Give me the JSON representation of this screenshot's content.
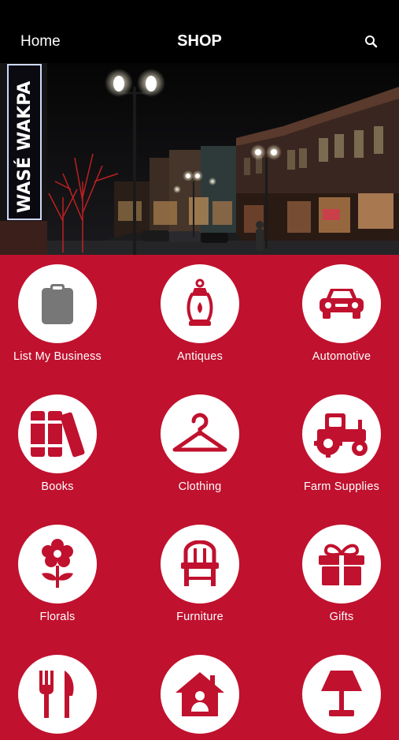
{
  "nav": {
    "left_label": "Home",
    "title": "SHOP",
    "search_icon": "search-icon"
  },
  "hero": {
    "sign_text": "WASÉ WAKPA",
    "description": "night-street-banner"
  },
  "colors": {
    "brand_red": "#c0112e",
    "topbar": "#000000",
    "icon_gray": "#7a7a7a"
  },
  "categories": [
    {
      "label": "List My Business",
      "icon": "clipboard-icon"
    },
    {
      "label": "Antiques",
      "icon": "lantern-icon"
    },
    {
      "label": "Automotive",
      "icon": "car-icon"
    },
    {
      "label": "Books",
      "icon": "books-icon"
    },
    {
      "label": "Clothing",
      "icon": "hanger-icon"
    },
    {
      "label": "Farm Supplies",
      "icon": "tractor-icon"
    },
    {
      "label": "Florals",
      "icon": "flower-icon"
    },
    {
      "label": "Furniture",
      "icon": "chair-icon"
    },
    {
      "label": "Gifts",
      "icon": "gift-icon"
    },
    {
      "label": "",
      "icon": "fork-knife-icon"
    },
    {
      "label": "",
      "icon": "house-person-icon"
    },
    {
      "label": "",
      "icon": "lamp-icon"
    }
  ]
}
